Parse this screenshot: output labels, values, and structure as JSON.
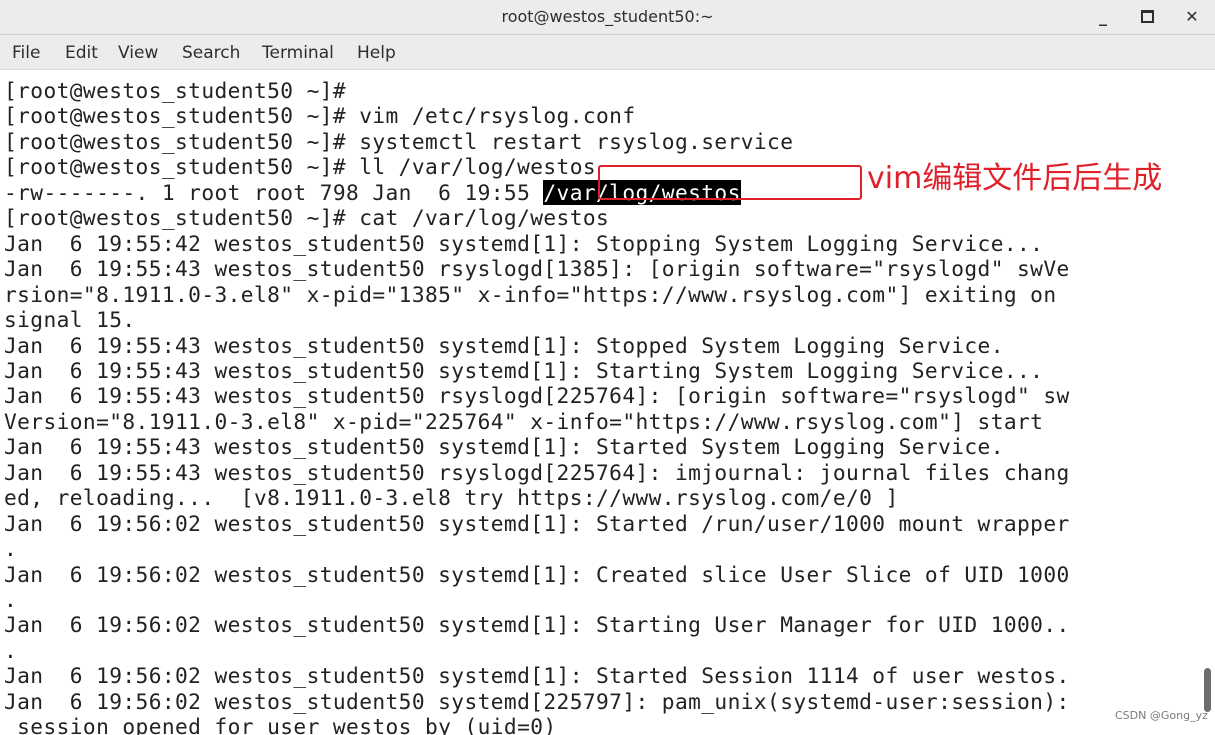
{
  "window": {
    "title": "root@westos_student50:~",
    "minimize_glyph": "_",
    "close_glyph": "✕"
  },
  "menu": [
    "File",
    "Edit",
    "View",
    "Search",
    "Terminal",
    "Help"
  ],
  "terminal": {
    "lines": [
      "[root@westos_student50 ~]#",
      "[root@westos_student50 ~]# vim /etc/rsyslog.conf",
      "[root@westos_student50 ~]# systemctl restart rsyslog.service",
      "[root@westos_student50 ~]# ll /var/log/westos",
      "-rw-------. 1 root root 798 Jan  6 19:55 ",
      "[root@westos_student50 ~]# cat /var/log/westos",
      "Jan  6 19:55:42 westos_student50 systemd[1]: Stopping System Logging Service...",
      "Jan  6 19:55:43 westos_student50 rsyslogd[1385]: [origin software=\"rsyslogd\" swVe",
      "rsion=\"8.1911.0-3.el8\" x-pid=\"1385\" x-info=\"https://www.rsyslog.com\"] exiting on",
      "signal 15.",
      "Jan  6 19:55:43 westos_student50 systemd[1]: Stopped System Logging Service.",
      "Jan  6 19:55:43 westos_student50 systemd[1]: Starting System Logging Service...",
      "Jan  6 19:55:43 westos_student50 rsyslogd[225764]: [origin software=\"rsyslogd\" sw",
      "Version=\"8.1911.0-3.el8\" x-pid=\"225764\" x-info=\"https://www.rsyslog.com\"] start",
      "Jan  6 19:55:43 westos_student50 systemd[1]: Started System Logging Service.",
      "Jan  6 19:55:43 westos_student50 rsyslogd[225764]: imjournal: journal files chang",
      "ed, reloading...  [v8.1911.0-3.el8 try https://www.rsyslog.com/e/0 ]",
      "Jan  6 19:56:02 westos_student50 systemd[1]: Started /run/user/1000 mount wrapper",
      ".",
      "Jan  6 19:56:02 westos_student50 systemd[1]: Created slice User Slice of UID 1000",
      ".",
      "Jan  6 19:56:02 westos_student50 systemd[1]: Starting User Manager for UID 1000..",
      ".",
      "Jan  6 19:56:02 westos_student50 systemd[1]: Started Session 1114 of user westos.",
      "Jan  6 19:56:02 westos_student50 systemd[225797]: pam_unix(systemd-user:session):",
      " session opened for user westos by (uid=0)"
    ],
    "highlighted_path": "/var/log/westos"
  },
  "annotation": {
    "text": "vim编辑文件后后生成",
    "color": "#e0202a"
  },
  "watermark": "CSDN @Gong_yz"
}
